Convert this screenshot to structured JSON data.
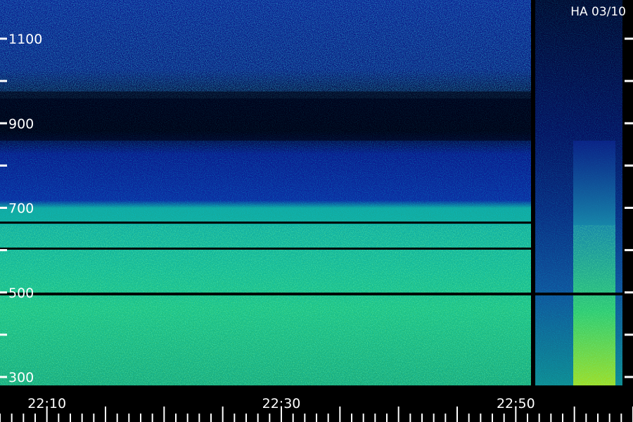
{
  "plot": {
    "label": "HA 03/10",
    "y_axis": {
      "tick_labels": [
        {
          "text": "1100",
          "value": 1100
        },
        {
          "text": "900",
          "value": 900
        },
        {
          "text": "700",
          "value": 700
        },
        {
          "text": "500",
          "value": 500
        },
        {
          "text": "300",
          "value": 300
        }
      ],
      "range": [
        300,
        1100
      ]
    },
    "x_axis": {
      "tick_labels": [
        {
          "text": "22:10",
          "value": "22:10"
        },
        {
          "text": "22:30",
          "value": "22:30"
        },
        {
          "text": "22:50",
          "value": "22:50"
        }
      ],
      "range": [
        "22:06",
        "23:00"
      ]
    },
    "colors": {
      "background": "#000000",
      "low": "#0a1a8a",
      "mid": "#00b0d0",
      "high": "#30e060",
      "peak": "#e0a020",
      "axis": "#ffffff"
    }
  }
}
